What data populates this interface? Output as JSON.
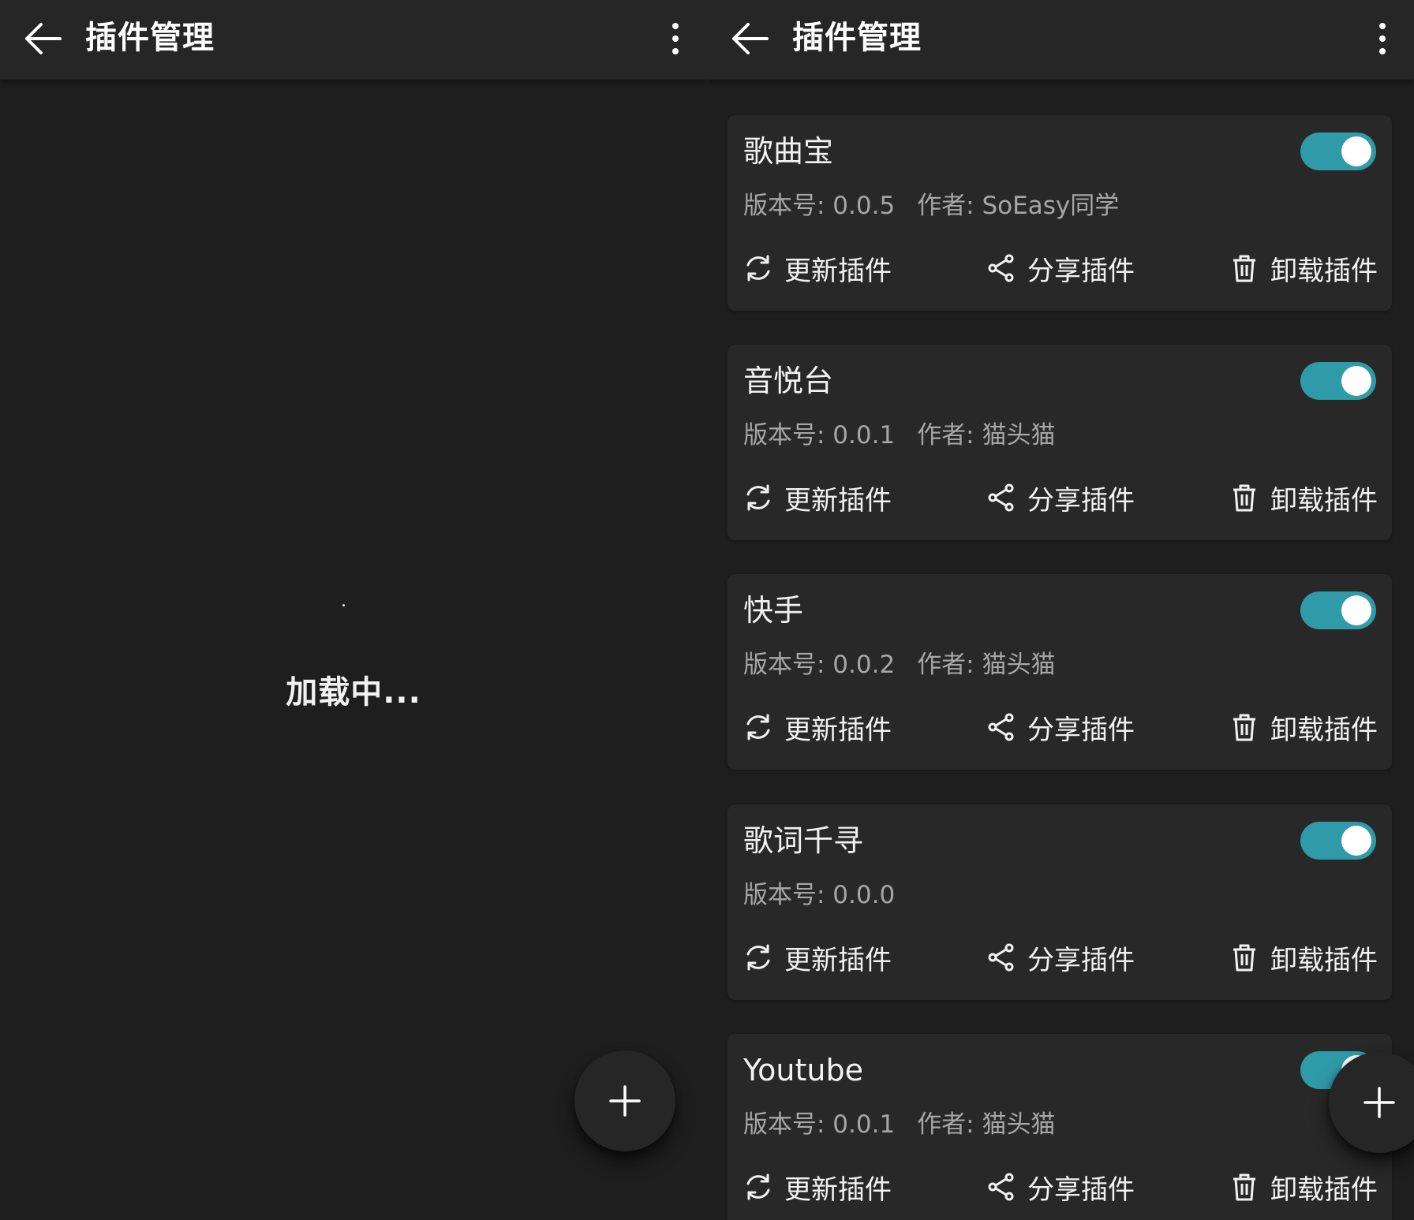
{
  "left_screen": {
    "title": "插件管理",
    "loading_text": "加载中..."
  },
  "right_screen": {
    "title": "插件管理",
    "plugins": [
      {
        "name": "歌曲宝",
        "version": "版本号: 0.0.5",
        "author": "作者: SoEasy同学",
        "enabled": true
      },
      {
        "name": "音悦台",
        "version": "版本号: 0.0.1",
        "author": "作者: 猫头猫",
        "enabled": true
      },
      {
        "name": "快手",
        "version": "版本号: 0.0.2",
        "author": "作者: 猫头猫",
        "enabled": true
      },
      {
        "name": "歌词千寻",
        "version": "版本号: 0.0.0",
        "author": "",
        "enabled": true
      },
      {
        "name": "Youtube",
        "version": "版本号: 0.0.1",
        "author": "作者: 猫头猫",
        "enabled": true
      }
    ]
  },
  "actions": {
    "update": "更新插件",
    "share": "分享插件",
    "uninstall": "卸载插件"
  },
  "colors": {
    "background": "#1e1e1e",
    "topbar": "#262626",
    "card": "#282828",
    "toggle_on": "#2f9aa8",
    "meta_text": "#a6a6a6"
  },
  "icons": [
    "arrow-left-icon",
    "more-vertical-icon",
    "plus-icon",
    "refresh-icon",
    "share-icon",
    "trash-icon"
  ]
}
